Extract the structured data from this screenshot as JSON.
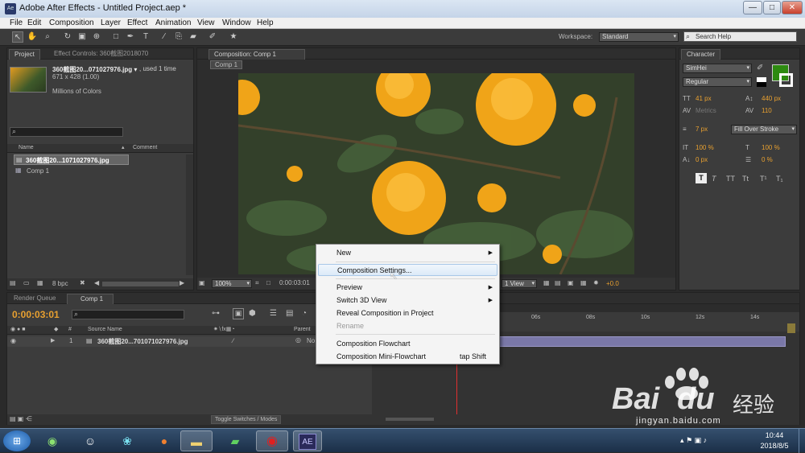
{
  "window": {
    "title": "Adobe After Effects - Untitled Project.aep *",
    "app_icon": "Ae",
    "buttons": [
      "—",
      "□",
      "✕"
    ]
  },
  "menu": [
    "File",
    "Edit",
    "Composition",
    "Layer",
    "Effect",
    "Animation",
    "View",
    "Window",
    "Help"
  ],
  "toolbar": {
    "tools": [
      "selection-tool-icon",
      "hand-tool-icon",
      "zoom-tool-icon",
      "rotate-tool-icon",
      "camera-tool-icon",
      "pan-behind-tool-icon",
      "mask-tool-icon",
      "pen-tool-icon",
      "text-tool-icon",
      "brush-tool-icon",
      "clone-tool-icon",
      "eraser-tool-icon",
      "roto-tool-icon",
      "puppet-tool-icon"
    ],
    "workspace_label": "Workspace:",
    "workspace_value": "Standard",
    "search_placeholder": "Search Help"
  },
  "project": {
    "tab": "Project",
    "effect_tab": "Effect Controls: 360截图2018070",
    "file_name": "360截图20...071027976.jpg ▾",
    "used": ", used 1 time",
    "dims": "671 x 428 (1.00)",
    "colors": "Millions of Colors",
    "col_name": "Name",
    "col_comment": "Comment",
    "items": [
      {
        "name": "360截图20...1071027976.jpg",
        "selected": true
      },
      {
        "name": "Comp 1",
        "selected": false
      }
    ],
    "bpc": "8 bpc"
  },
  "composition": {
    "tab": "Composition: Comp 1",
    "subtab": "Comp 1",
    "zoom": "100%",
    "timecode": "0:00:03:01",
    "view": "1 View",
    "exposure": "+0.0"
  },
  "character": {
    "tab": "Character",
    "font": "SimHei",
    "style": "Regular",
    "size": "41 px",
    "leading": "440 px",
    "kerning": "Metrics",
    "tracking": "110",
    "stroke_width": "7 px",
    "stroke_type": "Fill Over Stroke",
    "vscale": "100 %",
    "hscale": "100 %",
    "baseline": "0 px",
    "tsume": "0 %",
    "fill_color": "#2d8a10",
    "styles": [
      "T",
      "T",
      "TT",
      "Tt",
      "T¹",
      "T₁"
    ]
  },
  "timeline": {
    "render_tab": "Render Queue",
    "comp_tab": "Comp 1",
    "timecode": "0:00:03:01",
    "col_source": "Source Name",
    "col_parent": "Parent",
    "layer_num": "1",
    "layer_name": "360截图20...701071027976.jpg",
    "parent_val": "No",
    "ticks": [
      "06s",
      "08s",
      "10s",
      "12s",
      "14s"
    ],
    "toggle": "Toggle Switches / Modes"
  },
  "context_menu": {
    "items": [
      {
        "label": "New",
        "arrow": true
      },
      {
        "label": "Composition Settings...",
        "highlight": true
      },
      {
        "label": "Preview",
        "arrow": true
      },
      {
        "label": "Switch 3D View",
        "arrow": true
      },
      {
        "label": "Reveal Composition in Project"
      },
      {
        "label": "Rename",
        "disabled": true
      },
      {
        "label": "Composition Flowchart"
      },
      {
        "label": "Composition Mini-Flowchart",
        "shortcut": "tap Shift"
      }
    ]
  },
  "taskbar": {
    "time": "10:44",
    "date": "2018/8/5",
    "apps": [
      "windows-start-icon",
      "360-browser-icon",
      "qq-icon",
      "media-player-icon",
      "firefox-icon",
      "file-explorer-icon",
      "media-app-icon",
      "recorder-icon",
      "after-effects-icon"
    ]
  },
  "watermark": {
    "brand": "Bai",
    "brand2": "du",
    "cn": "经验",
    "url": "jingyan.baidu.com"
  }
}
